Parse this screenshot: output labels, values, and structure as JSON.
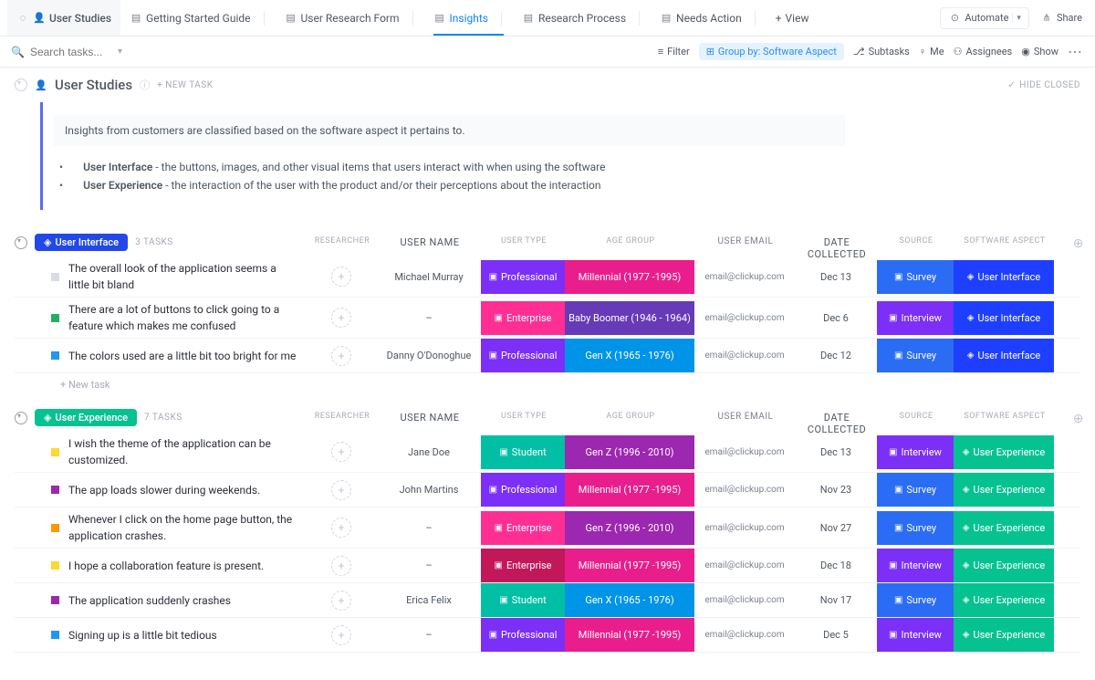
{
  "topbar": {
    "project": "User Studies",
    "tabs": [
      {
        "label": "Getting Started Guide"
      },
      {
        "label": "User Research Form"
      },
      {
        "label": "Insights",
        "active": true
      },
      {
        "label": "Research Process"
      },
      {
        "label": "Needs Action"
      }
    ],
    "add_view": "View",
    "automate": "Automate",
    "share": "Share"
  },
  "toolbar": {
    "search_placeholder": "Search tasks...",
    "filter": "Filter",
    "group_by": "Group by: Software Aspect",
    "subtasks": "Subtasks",
    "me": "Me",
    "assignees": "Assignees",
    "show": "Show"
  },
  "header": {
    "title": "User Studies",
    "new_task": "+ NEW TASK",
    "hide_closed": "HIDE CLOSED"
  },
  "description": {
    "intro": "Insights from customers are classified based on the software aspect it pertains to.",
    "items": [
      {
        "term": "User Interface",
        "text": " - the buttons, images, and other visual items that users interact with when using the software"
      },
      {
        "term": "User Experience",
        "text": " - the interaction of the user with the product and/or their perceptions about the interaction"
      }
    ]
  },
  "columns": {
    "researcher": "RESEARCHER",
    "username": "USER NAME",
    "usertype": "USER TYPE",
    "agegroup": "AGE GROUP",
    "useremail": "USER EMAIL",
    "datecol": "DATE COLLECTED",
    "source": "SOURCE",
    "aspect": "SOFTWARE ASPECT"
  },
  "groups": [
    {
      "name": "User Interface",
      "class": "ui",
      "count": "3 TASKS",
      "rows": [
        {
          "status": "status-ui1",
          "name": "The overall look of the application seems a little bit bland",
          "username": "Michael Murray",
          "usertype": "Professional",
          "usertype_bg": "bg-purple",
          "agegroup": "Millennial (1977 -1995)",
          "agegroup_bg": "bg-hotpink",
          "email": "email@clickup.com",
          "date": "Dec 13",
          "source": "Survey",
          "source_bg": "bg-blue",
          "aspect": "User Interface",
          "aspect_bg": "bg-bblue"
        },
        {
          "status": "status-ui2",
          "name": "There are a lot of buttons to click going to a feature which makes me confused",
          "username": "–",
          "usertype": "Enterprise",
          "usertype_bg": "bg-pink",
          "agegroup": "Baby Boomer (1946 - 1964)",
          "agegroup_bg": "bg-violet",
          "email": "email@clickup.com",
          "date": "Dec 6",
          "source": "Interview",
          "source_bg": "bg-purple",
          "aspect": "User Interface",
          "aspect_bg": "bg-bblue"
        },
        {
          "status": "status-ui3",
          "name": "The colors used are a little bit too bright for me",
          "username": "Danny O'Donoghue",
          "usertype": "Professional",
          "usertype_bg": "bg-purple",
          "agegroup": "Gen X (1965 - 1976)",
          "agegroup_bg": "bg-cyan",
          "email": "email@clickup.com",
          "date": "Dec 12",
          "source": "Survey",
          "source_bg": "bg-blue",
          "aspect": "User Interface",
          "aspect_bg": "bg-bblue"
        }
      ],
      "new_task": "+ New task"
    },
    {
      "name": "User Experience",
      "class": "ux",
      "count": "7 TASKS",
      "rows": [
        {
          "status": "status-ux1",
          "name": "I wish the theme of the application can be customized.",
          "username": "Jane Doe",
          "usertype": "Student",
          "usertype_bg": "bg-teal",
          "agegroup": "Gen Z (1996 - 2010)",
          "agegroup_bg": "bg-bpurple",
          "email": "email@clickup.com",
          "date": "Dec 13",
          "source": "Interview",
          "source_bg": "bg-purple",
          "aspect": "User Experience",
          "aspect_bg": "bg-green"
        },
        {
          "status": "status-ux2",
          "name": "The app loads slower during weekends.",
          "username": "John Martins",
          "usertype": "Professional",
          "usertype_bg": "bg-purple",
          "agegroup": "Millennial (1977 -1995)",
          "agegroup_bg": "bg-hotpink",
          "email": "email@clickup.com",
          "date": "Nov 23",
          "source": "Survey",
          "source_bg": "bg-blue",
          "aspect": "User Experience",
          "aspect_bg": "bg-green"
        },
        {
          "status": "status-ux3",
          "name": "Whenever I click on the home page button, the application crashes.",
          "username": "–",
          "usertype": "Enterprise",
          "usertype_bg": "bg-pink",
          "agegroup": "Gen Z (1996 - 2010)",
          "agegroup_bg": "bg-bpurple",
          "email": "email@clickup.com",
          "date": "Nov 27",
          "source": "Survey",
          "source_bg": "bg-blue",
          "aspect": "User Experience",
          "aspect_bg": "bg-green"
        },
        {
          "status": "status-ux4",
          "name": "I hope a collaboration feature is present.",
          "username": "–",
          "usertype": "Enterprise",
          "usertype_bg": "bg-magenta",
          "agegroup": "Millennial (1977 -1995)",
          "agegroup_bg": "bg-hotpink",
          "email": "email@clickup.com",
          "date": "Dec 18",
          "source": "Interview",
          "source_bg": "bg-purple",
          "aspect": "User Experience",
          "aspect_bg": "bg-green"
        },
        {
          "status": "status-ux5",
          "name": "The application suddenly crashes",
          "username": "Erica Felix",
          "usertype": "Student",
          "usertype_bg": "bg-teal",
          "agegroup": "Gen X (1965 - 1976)",
          "agegroup_bg": "bg-cyan",
          "email": "email@clickup.com",
          "date": "Nov 17",
          "source": "Survey",
          "source_bg": "bg-blue",
          "aspect": "User Experience",
          "aspect_bg": "bg-green"
        },
        {
          "status": "status-ux6",
          "name": "Signing up is a little bit tedious",
          "username": "–",
          "usertype": "Professional",
          "usertype_bg": "bg-purple",
          "agegroup": "Millennial (1977 -1995)",
          "agegroup_bg": "bg-hotpink",
          "email": "email@clickup.com",
          "date": "Dec 5",
          "source": "Interview",
          "source_bg": "bg-purple",
          "aspect": "User Experience",
          "aspect_bg": "bg-green"
        }
      ]
    }
  ]
}
